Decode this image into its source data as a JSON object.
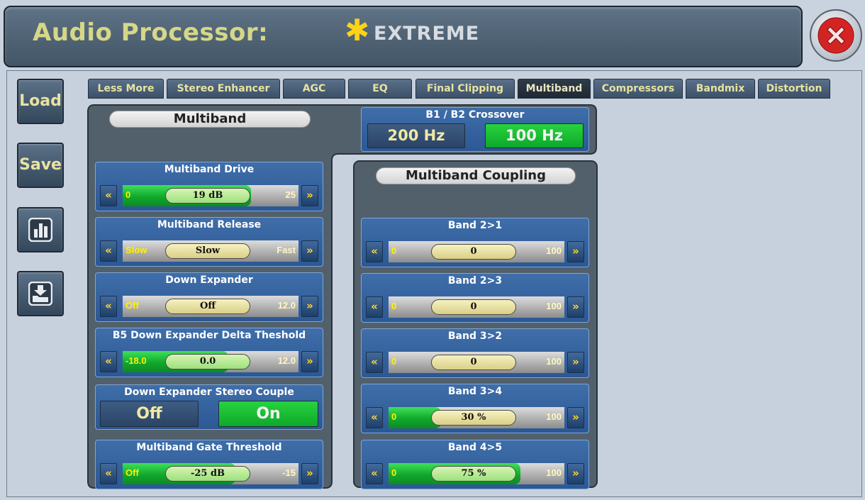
{
  "header": {
    "title": "Audio Processor:",
    "preset_symbol": "✱",
    "preset_name": "EXTREME",
    "close_icon": "close-icon"
  },
  "sidebar": {
    "load_label": "Load",
    "save_label": "Save",
    "meter_icon": "bar-chart-icon",
    "import_icon": "import-folder-icon"
  },
  "tabs": [
    {
      "label": "Less More"
    },
    {
      "label": "Stereo Enhancer"
    },
    {
      "label": "AGC"
    },
    {
      "label": "EQ"
    },
    {
      "label": "Final Clipping"
    },
    {
      "label": "Multiband",
      "active": true
    },
    {
      "label": "Compressors"
    },
    {
      "label": "Bandmix"
    },
    {
      "label": "Distortion"
    }
  ],
  "multiband": {
    "title": "Multiband",
    "crossover": {
      "label": "B1 / B2 Crossover",
      "options": [
        "200 Hz",
        "100 Hz"
      ],
      "selected": "100 Hz"
    },
    "controls": [
      {
        "label": "Multiband Drive",
        "min": "0",
        "max": "25",
        "value": "19 dB",
        "fill": 0.73
      },
      {
        "label": "Multiband Release",
        "min": "Slow",
        "max": "Fast",
        "value": "Slow",
        "fill": 0
      },
      {
        "label": "Down Expander",
        "min": "Off",
        "max": "12.0",
        "value": "Off",
        "fill": 0
      },
      {
        "label": "B5 Down Expander Delta Theshold",
        "min": "-18.0",
        "max": "12.0",
        "value": "0.0",
        "fill": 0.6
      },
      {
        "label": "Multiband Gate Threshold",
        "min": "Off",
        "max": "-15",
        "value": "-25 dB",
        "fill": 0.64
      }
    ],
    "stereo_couple": {
      "label": "Down Expander Stereo Couple",
      "off_label": "Off",
      "on_label": "On",
      "selected": "On"
    }
  },
  "coupling": {
    "title": "Multiband Coupling",
    "controls": [
      {
        "label": "Band 2>1",
        "min": "0",
        "max": "100",
        "value": "0",
        "fill": 0
      },
      {
        "label": "Band 2>3",
        "min": "0",
        "max": "100",
        "value": "0",
        "fill": 0
      },
      {
        "label": "Band 3>2",
        "min": "0",
        "max": "100",
        "value": "0",
        "fill": 0
      },
      {
        "label": "Band 3>4",
        "min": "0",
        "max": "100",
        "value": "30 %",
        "fill": 0.3
      },
      {
        "label": "Band 4>5",
        "min": "0",
        "max": "100",
        "value": "75 %",
        "fill": 0.75
      }
    ]
  },
  "arrows": {
    "left": "«",
    "right": "»"
  },
  "colors": {
    "accent_green": "#15b52f",
    "label_yellow": "#e6e3a1",
    "arrow_yellow": "#ffd933",
    "panel_bg": "#52606c",
    "control_blue": "#3266a4"
  }
}
